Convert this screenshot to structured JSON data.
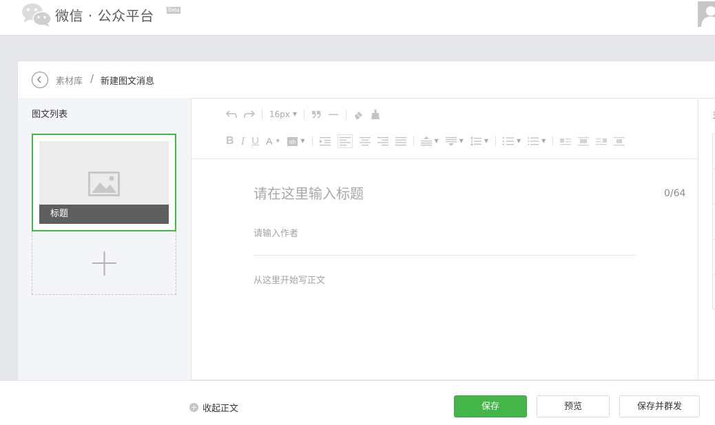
{
  "header": {
    "brand": "微信 · 公众平台",
    "badge": "Beta"
  },
  "breadcrumb": {
    "root": "素材库",
    "separator": "/",
    "current": "新建图文消息"
  },
  "article_list": {
    "title": "图文列表",
    "items": [
      {
        "caption": "标题"
      }
    ]
  },
  "toolbar": {
    "font_size": "16px"
  },
  "editor": {
    "title_placeholder": "请在这里输入标题",
    "title_counter": "0/64",
    "author_placeholder": "请输入作者",
    "body_placeholder": "从这里开始写正文"
  },
  "right_panel": {
    "label_partial": "多"
  },
  "footer": {
    "collapse_label": "收起正文",
    "save_label": "保存",
    "preview_label": "预览",
    "publish_label": "保存并群发"
  },
  "colors": {
    "accent": "#44b549",
    "icon_gray": "#c4c4c4"
  }
}
